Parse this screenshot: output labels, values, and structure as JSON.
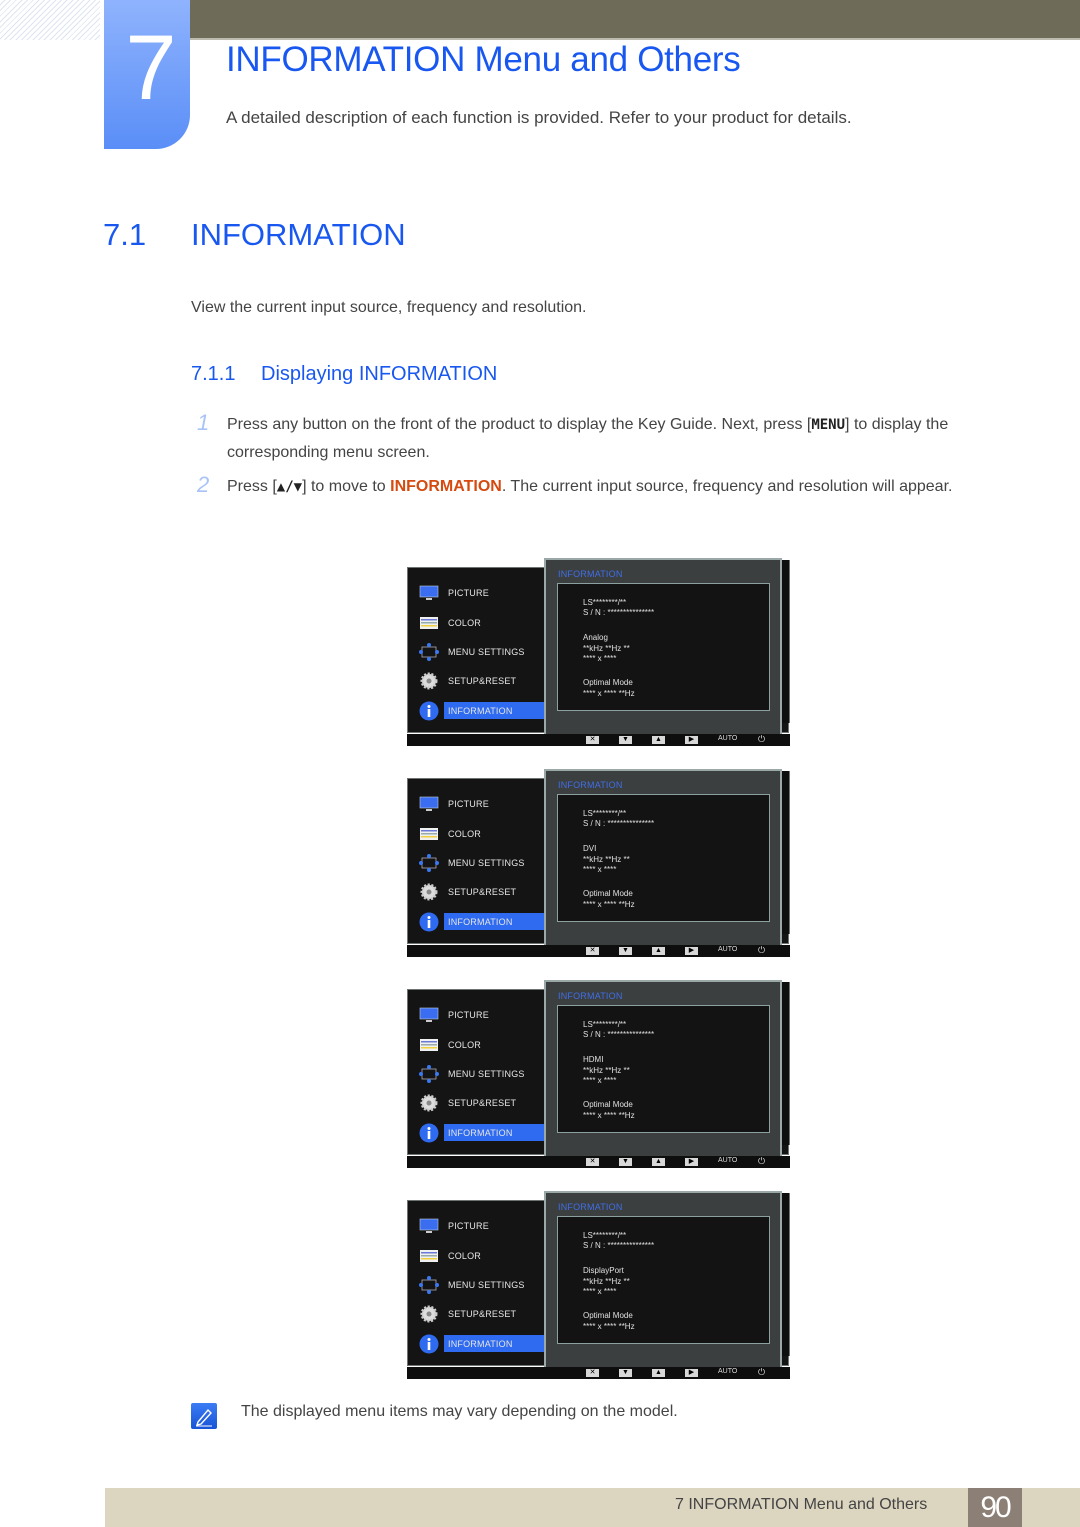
{
  "chapter": {
    "number": "7",
    "title": "INFORMATION Menu and Others",
    "description": "A detailed description of each function is provided. Refer to your product for details."
  },
  "section": {
    "number": "7.1",
    "title": "INFORMATION",
    "description": "View the current input source, frequency and resolution."
  },
  "subsection": {
    "number": "7.1.1",
    "title": "Displaying INFORMATION"
  },
  "steps": [
    {
      "number": "1",
      "text_before": "Press any button on the front of the product to display the Key Guide. Next, press [",
      "key": "MENU",
      "text_after": "] to display the corresponding menu screen."
    },
    {
      "number": "2",
      "text_before": "Press [",
      "key": "▲/▼",
      "text_middle": "] to move to ",
      "highlight": "INFORMATION",
      "text_after": ". The current input source, frequency and resolution will appear."
    }
  ],
  "osd": {
    "menu_items": [
      {
        "label": "PICTURE",
        "icon": "monitor-icon"
      },
      {
        "label": "COLOR",
        "icon": "color-bars-icon"
      },
      {
        "label": "MENU SETTINGS",
        "icon": "menu-settings-icon"
      },
      {
        "label": "SETUP&RESET",
        "icon": "gear-icon"
      },
      {
        "label": "INFORMATION",
        "icon": "info-icon",
        "selected": true
      }
    ],
    "panel_title": "INFORMATION",
    "model": "LS********/**",
    "serial": "S / N : ***************",
    "frequency": "**kHz **Hz **",
    "resolution": "**** x ****",
    "optimal_label": "Optimal Mode",
    "optimal_value": "**** x **** **Hz",
    "keybar": {
      "auto_label": "AUTO"
    },
    "screens": [
      {
        "source": "Analog"
      },
      {
        "source": "DVI"
      },
      {
        "source": "HDMI"
      },
      {
        "source": "DisplayPort"
      }
    ]
  },
  "note": {
    "text": "The displayed menu items may vary depending on the model."
  },
  "footer": {
    "chapter_label": "7 INFORMATION Menu and Others",
    "page_number": "90"
  },
  "colors": {
    "accent_blue": "#1958f0",
    "highlight_orange": "#d64a10",
    "header_bar": "#6e6b59",
    "footer_bar": "#dcd5c0",
    "page_badge": "#8c7f76"
  }
}
